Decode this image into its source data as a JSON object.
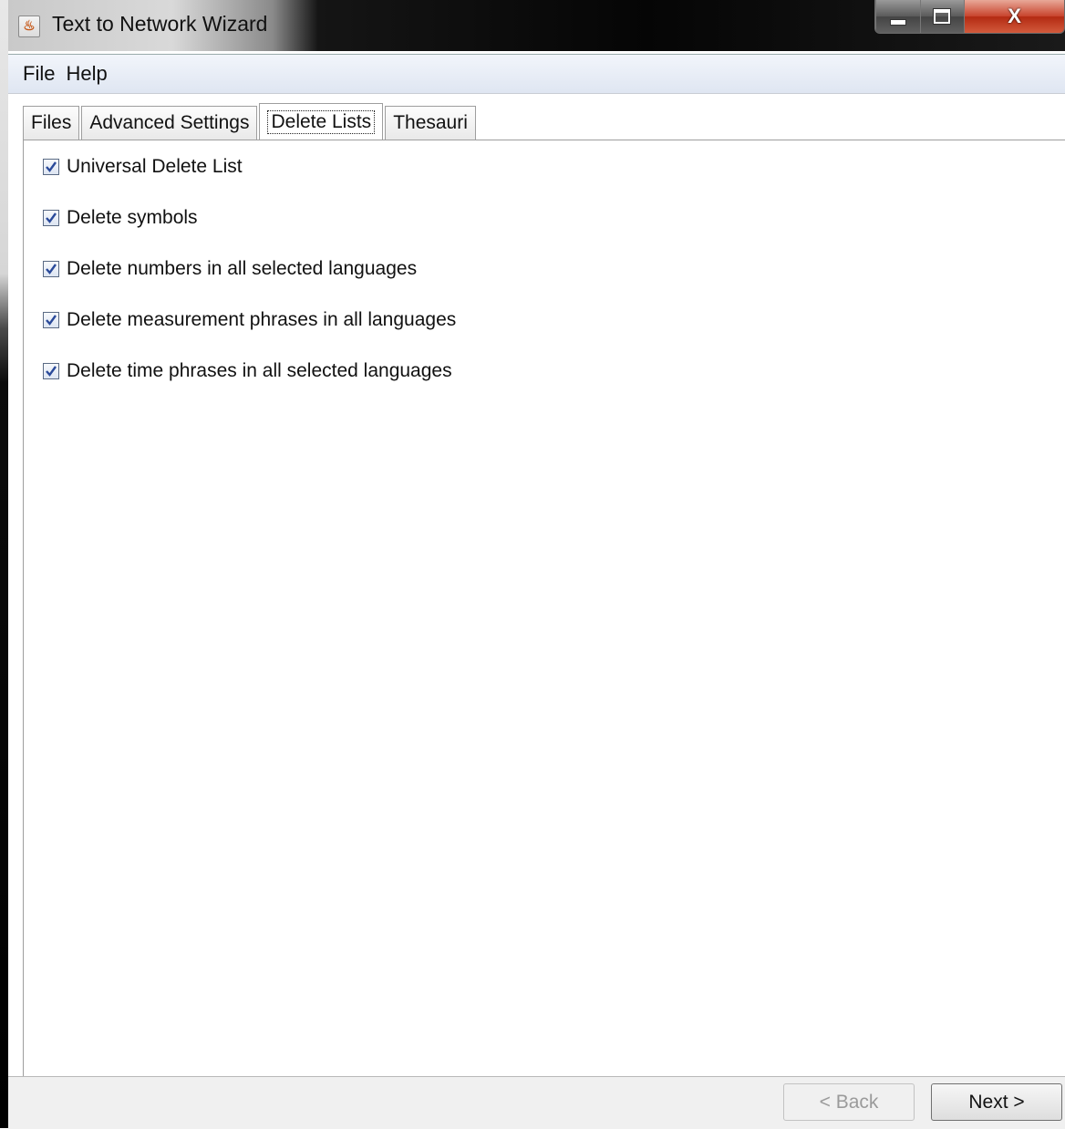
{
  "window": {
    "title": "Text to Network Wizard",
    "icons": {
      "app": "java-coffee-icon",
      "min": "minimize-icon",
      "max": "maximize-icon",
      "close": "close-icon"
    },
    "close_glyph": "X"
  },
  "menu": [
    "File",
    "Help"
  ],
  "tabs": [
    {
      "label": "Files",
      "active": false
    },
    {
      "label": "Advanced Settings",
      "active": false
    },
    {
      "label": "Delete Lists",
      "active": true
    },
    {
      "label": "Thesauri",
      "active": false
    }
  ],
  "options": [
    {
      "label": "Universal Delete List",
      "checked": true
    },
    {
      "label": "Delete symbols",
      "checked": true
    },
    {
      "label": "Delete numbers in all selected languages",
      "checked": true
    },
    {
      "label": "Delete measurement phrases in all languages",
      "checked": true
    },
    {
      "label": "Delete time phrases in all selected languages",
      "checked": true
    }
  ],
  "buttons": {
    "back": {
      "label": "< Back",
      "enabled": false
    },
    "next": {
      "label": "Next >",
      "enabled": true
    }
  }
}
